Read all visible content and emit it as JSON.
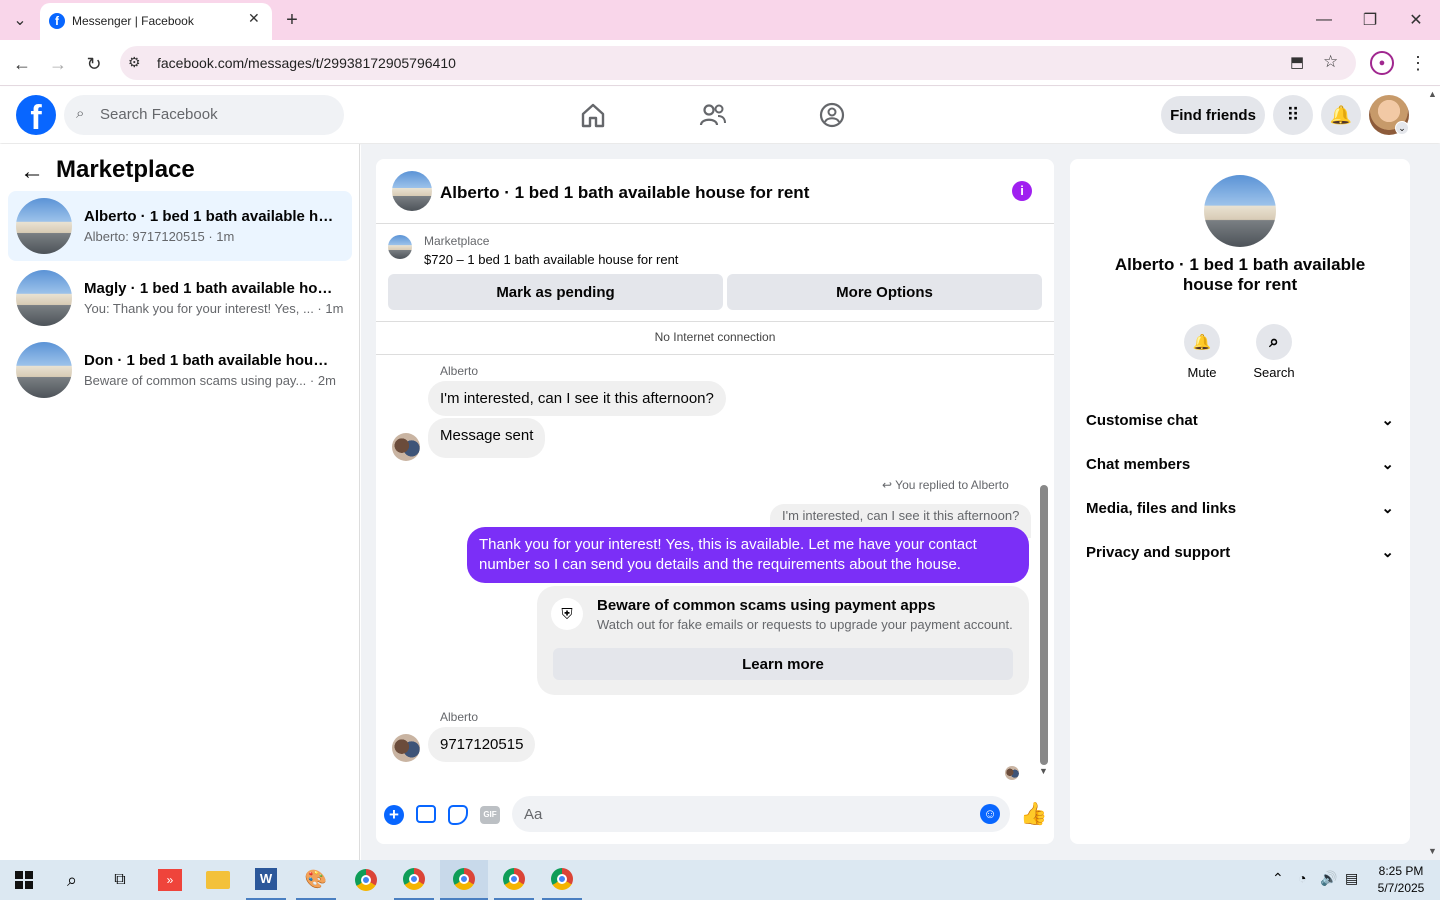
{
  "browser": {
    "tab_title": "Messenger | Facebook",
    "url": "facebook.com/messages/t/29938172905796410"
  },
  "fb": {
    "search_placeholder": "Search Facebook",
    "find_friends": "Find friends"
  },
  "sidebar": {
    "title": "Marketplace",
    "conversations": [
      {
        "title": "Alberto · 1 bed 1 bath available ho...",
        "snippet": "Alberto: 9717120515 · 1m"
      },
      {
        "title": "Magly · 1 bed 1 bath available hou...",
        "snippet": "You: Thank you for your interest! Yes, ... · 1m"
      },
      {
        "title": "Don · 1 bed 1 bath available house ...",
        "snippet": "Beware of common scams using pay... · 2m"
      }
    ]
  },
  "chat": {
    "title": "Alberto · 1 bed 1 bath available house for rent",
    "listing_source": "Marketplace",
    "listing_desc": "$720 – 1 bed 1 bath available house for rent",
    "mark_pending": "Mark as pending",
    "more_options": "More Options",
    "connection_status": "No Internet connection",
    "msg1_sender": "Alberto",
    "msg1_text": "I'm interested, can I see it this afternoon?",
    "msg2_text": "Message sent",
    "replied_label": "You replied to Alberto",
    "quoted_text": "I'm interested, can I see it this afternoon?",
    "my_reply": "Thank you for your interest! Yes, this is available. Let me have your contact number so I can send you details and the requirements about the house.",
    "scam_title": "Beware of common scams using payment apps",
    "scam_body": "Watch out for fake emails or requests to upgrade your payment account.",
    "learn_more": "Learn more",
    "msg3_sender": "Alberto",
    "msg3_text": "9717120515",
    "composer_placeholder": "Aa"
  },
  "details": {
    "title": "Alberto · 1 bed 1 bath available house for rent",
    "mute": "Mute",
    "search": "Search",
    "sections": [
      "Customise chat",
      "Chat members",
      "Media, files and links",
      "Privacy and support"
    ]
  },
  "taskbar": {
    "time": "8:25 PM",
    "date": "5/7/2025"
  },
  "colors": {
    "accent": "#7b2ff7",
    "fb_blue": "#0866ff",
    "info_icon": "#a020f0",
    "tab_bar": "#f9d6ea"
  }
}
